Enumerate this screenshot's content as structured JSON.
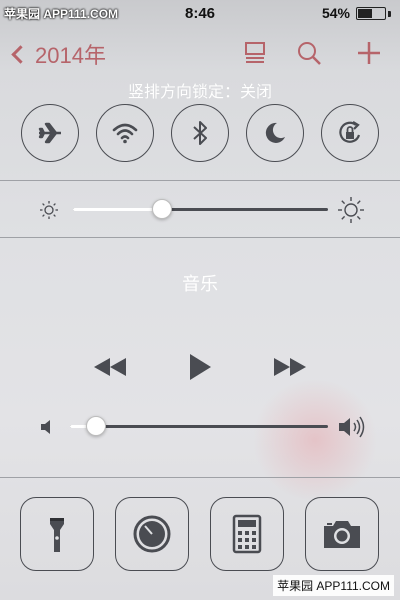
{
  "watermark": {
    "top": "苹果园 APP111.COM",
    "bottom": "苹果园 APP111.COM"
  },
  "status_bar": {
    "time": "8:46",
    "battery_percent": "54%",
    "battery_level": 0.54
  },
  "background_app": {
    "back_label": "2014年",
    "accent_color": "#b6646a"
  },
  "control_center": {
    "orientation_lock_label": "竖排方向锁定：关闭",
    "toggles": [
      {
        "name": "airplane-mode",
        "icon": "airplane-icon"
      },
      {
        "name": "wifi",
        "icon": "wifi-icon"
      },
      {
        "name": "bluetooth",
        "icon": "bluetooth-icon"
      },
      {
        "name": "do-not-disturb",
        "icon": "moon-icon"
      },
      {
        "name": "orientation-lock",
        "icon": "rotation-lock-icon"
      }
    ],
    "brightness": {
      "level": 0.35
    },
    "music": {
      "title": "音乐"
    },
    "volume": {
      "level": 0.1
    },
    "quick_launch": [
      {
        "name": "flashlight",
        "icon": "flashlight-icon"
      },
      {
        "name": "clock",
        "icon": "timer-icon"
      },
      {
        "name": "calculator",
        "icon": "calculator-icon"
      },
      {
        "name": "camera",
        "icon": "camera-icon"
      }
    ]
  },
  "colors": {
    "stroke": "#4a4c52",
    "label": "#ffffff"
  }
}
